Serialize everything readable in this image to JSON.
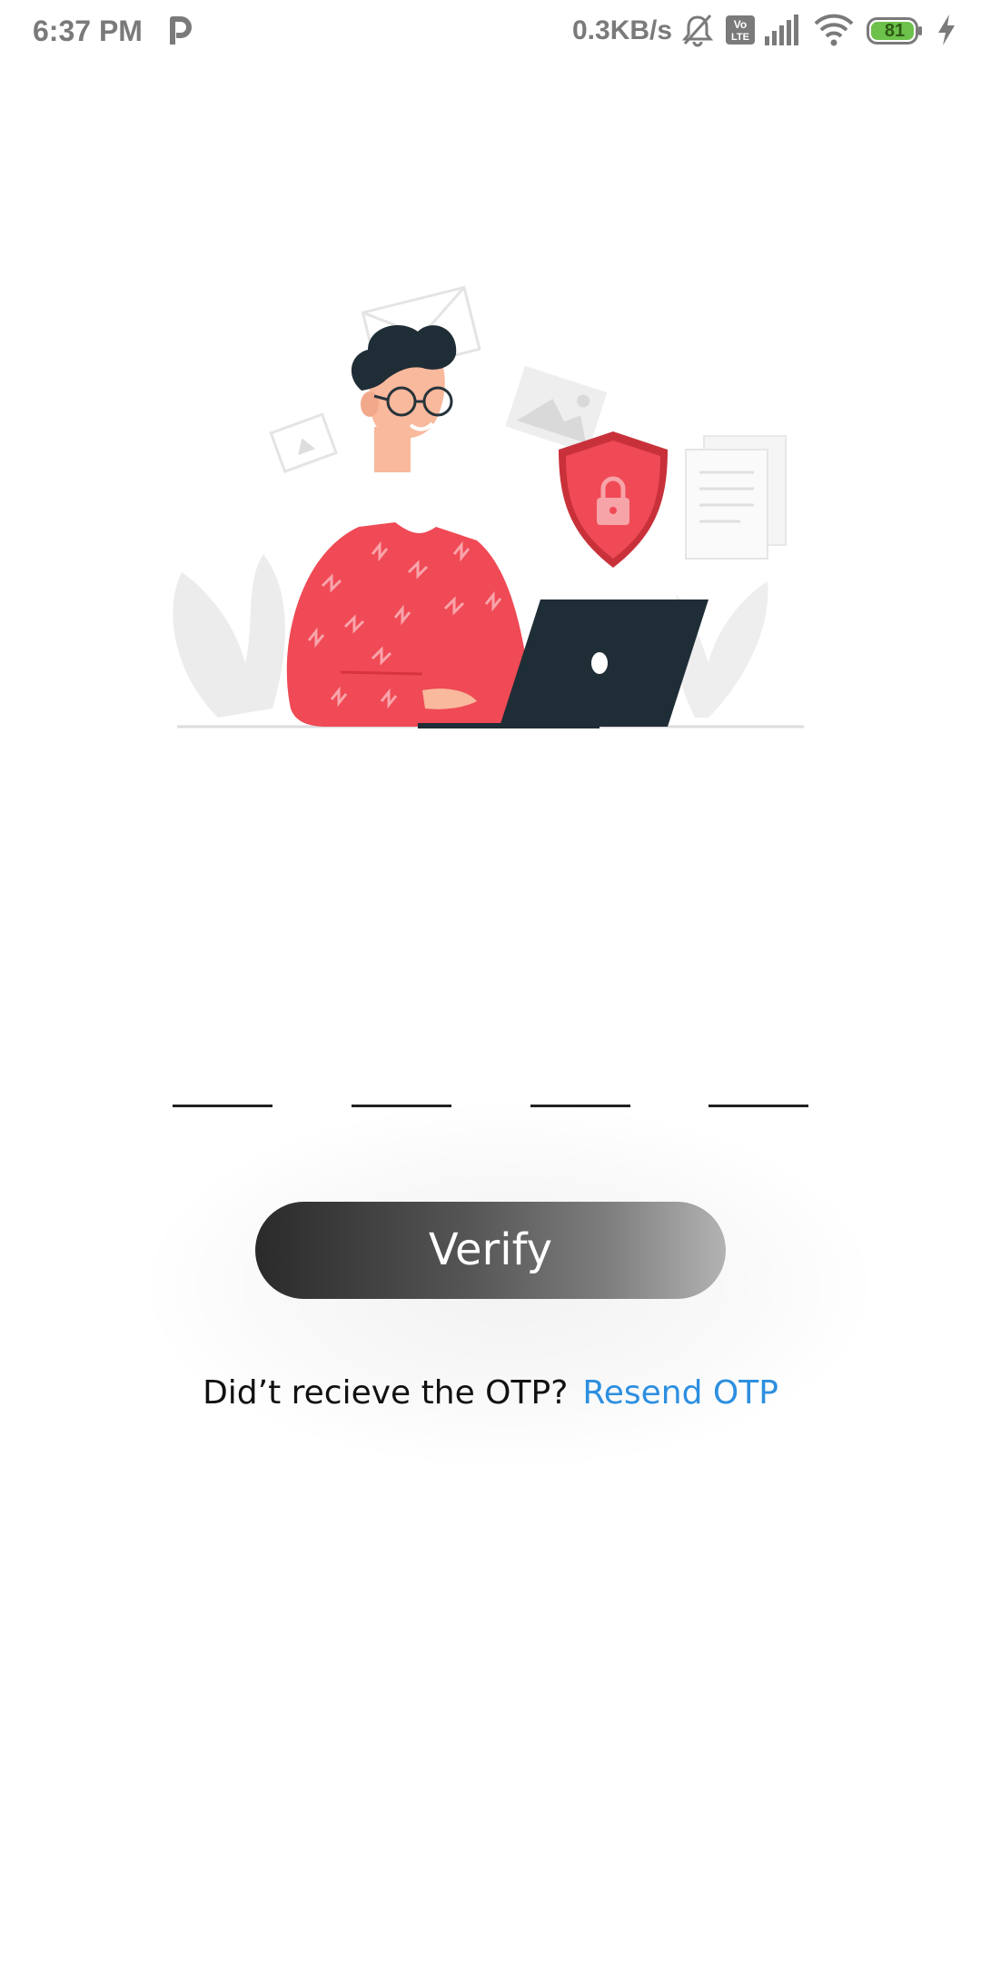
{
  "status_bar": {
    "time": "6:37 PM",
    "network_speed": "0.3KB/s",
    "battery_level": "81",
    "icons": [
      "parking-app-icon",
      "bell-muted-icon",
      "volte-icon",
      "signal-icon",
      "wifi-icon",
      "battery-icon",
      "charging-icon"
    ],
    "battery_color": "#6cc24a"
  },
  "illustration": {
    "subject": "person-at-laptop-security-illustration",
    "accent_color": "#ef4a55"
  },
  "otp": {
    "digits": [
      "",
      "",
      "",
      ""
    ]
  },
  "verify_button": {
    "label": "Verify"
  },
  "resend": {
    "prompt": "Did’t recieve the OTP?",
    "link": "Resend OTP",
    "link_color": "#2d8fe0"
  }
}
